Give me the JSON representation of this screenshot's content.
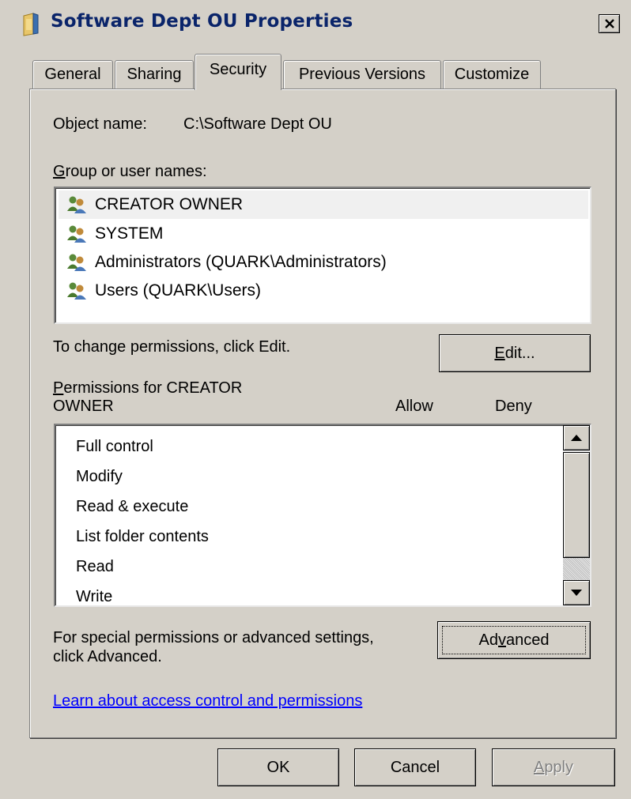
{
  "window": {
    "title": "Software Dept OU Properties"
  },
  "tabs": [
    {
      "label": "General"
    },
    {
      "label": "Sharing"
    },
    {
      "label": "Security",
      "active": true
    },
    {
      "label": "Previous Versions"
    },
    {
      "label": "Customize"
    }
  ],
  "security": {
    "object_name_label": "Object name:",
    "object_name_value": "C:\\Software Dept OU",
    "group_label_prefix": "G",
    "group_label_rest": "roup or user names:",
    "groups": [
      {
        "name": "CREATOR OWNER",
        "selected": true
      },
      {
        "name": "SYSTEM"
      },
      {
        "name": "Administrators (QUARK\\Administrators)"
      },
      {
        "name": "Users (QUARK\\Users)"
      }
    ],
    "change_text": "To change permissions, click Edit.",
    "edit_button_prefix": "E",
    "edit_button_rest": "dit...",
    "permissions_label_prefix": "P",
    "permissions_label_line1_rest": "ermissions for CREATOR",
    "permissions_label_line2": "OWNER",
    "col_allow": "Allow",
    "col_deny": "Deny",
    "permissions": [
      "Full control",
      "Modify",
      "Read & execute",
      "List folder contents",
      "Read",
      "Write"
    ],
    "special_text_line1": "For special permissions or advanced settings,",
    "special_text_line2": "click Advanced.",
    "advanced_button_a": "Ad",
    "advanced_button_v": "v",
    "advanced_button_rest": "anced",
    "learn_link": "Learn about access control and permissions"
  },
  "footer": {
    "ok": "OK",
    "cancel": "Cancel",
    "apply_prefix": "A",
    "apply_rest": "pply"
  },
  "icons": {
    "title": "folder-icon",
    "close": "close-icon",
    "user": "user-group-icon",
    "scroll_up": "scroll-up-icon",
    "scroll_down": "scroll-down-icon"
  },
  "colors": {
    "face": "#d4d0c8",
    "title_text": "#0a246a",
    "link": "#0000ff",
    "list_selected": "#f0f0f0"
  }
}
